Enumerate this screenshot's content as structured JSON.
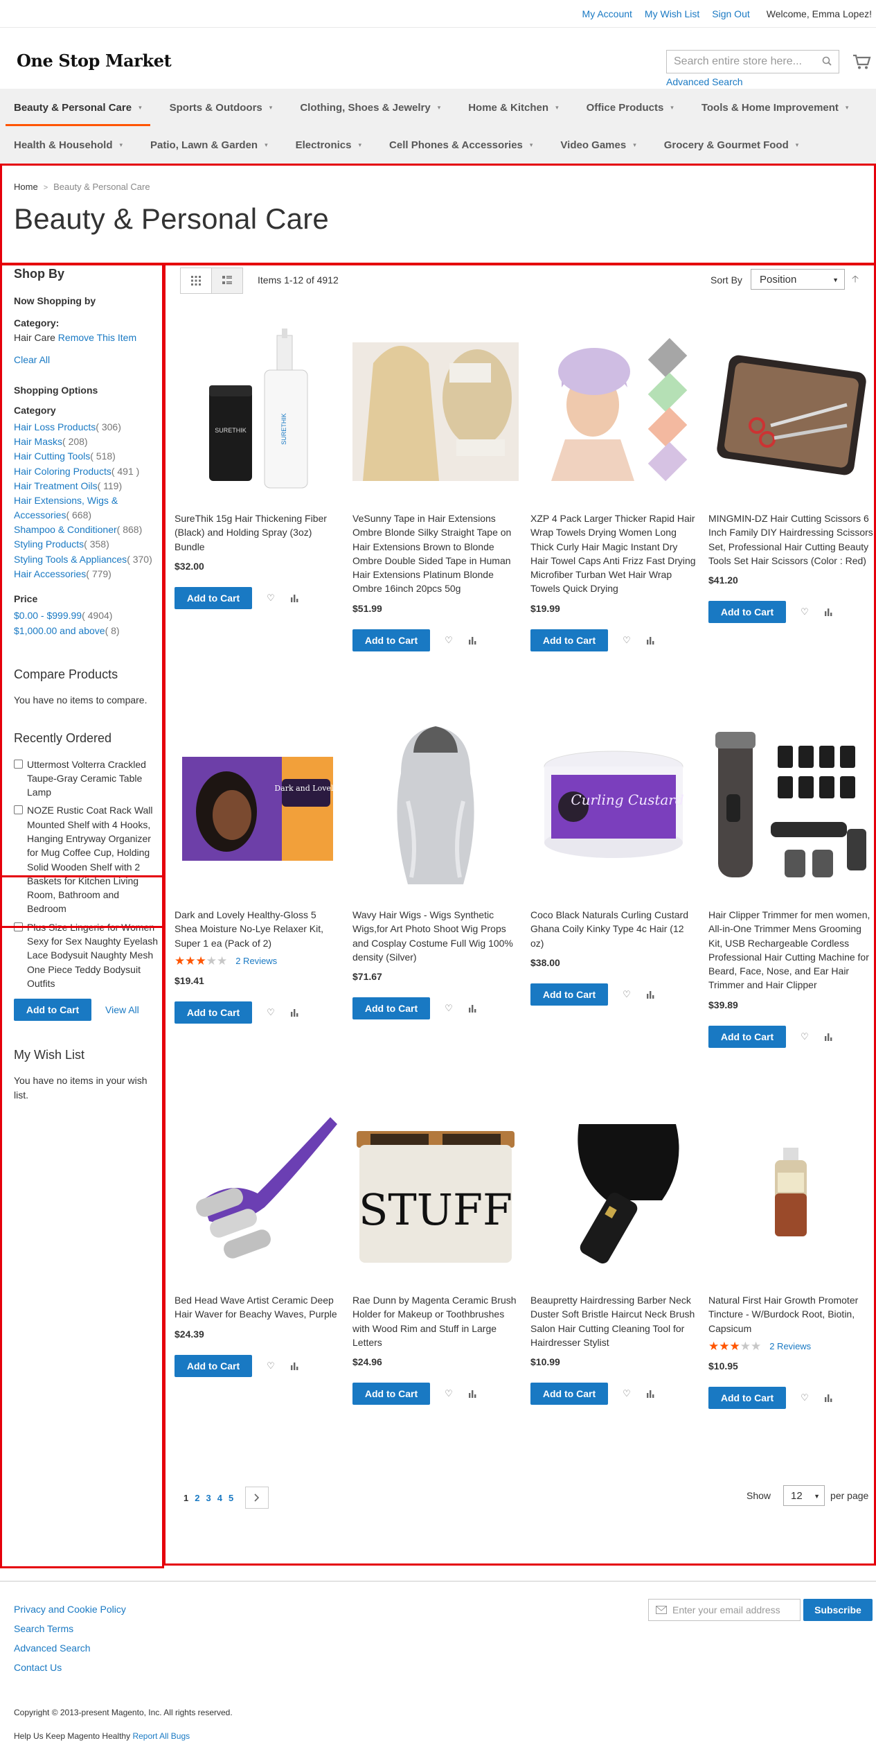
{
  "header": {
    "links": [
      "My Account",
      "My Wish List",
      "Sign Out"
    ],
    "welcome": "Welcome, Emma Lopez!",
    "logo": "One Stop Market",
    "search_placeholder": "Search entire store here...",
    "advanced_search": "Advanced Search"
  },
  "nav": {
    "row1": [
      "Beauty & Personal Care",
      "Sports & Outdoors",
      "Clothing, Shoes & Jewelry",
      "Home & Kitchen",
      "Office Products",
      "Tools & Home Improvement"
    ],
    "row2": [
      "Health & Household",
      "Patio, Lawn & Garden",
      "Electronics",
      "Cell Phones & Accessories",
      "Video Games",
      "Grocery & Gourmet Food"
    ]
  },
  "breadcrumb": {
    "home": "Home",
    "current": "Beauty & Personal Care"
  },
  "page_title": "Beauty & Personal Care",
  "sidebar": {
    "shop_by": "Shop By",
    "now_shopping_by": "Now Shopping by",
    "category_label": "Category:",
    "category_value": "Hair Care",
    "remove_item": "Remove This Item",
    "clear_all": "Clear All",
    "shopping_options": "Shopping Options",
    "category_heading": "Category",
    "categories": [
      {
        "name": "Hair Loss Products",
        "count": "( 306)"
      },
      {
        "name": "Hair Masks",
        "count": "( 208)"
      },
      {
        "name": "Hair Cutting Tools",
        "count": "( 518)"
      },
      {
        "name": "Hair Coloring Products",
        "count": "( 491 )"
      },
      {
        "name": "Hair Treatment Oils",
        "count": "( 119)"
      },
      {
        "name": "Hair Extensions, Wigs & Accessories",
        "count": "( 668)"
      },
      {
        "name": "Shampoo & Conditioner",
        "count": "( 868)"
      },
      {
        "name": "Styling Products",
        "count": "( 358)"
      },
      {
        "name": "Styling Tools & Appliances",
        "count": "( 370)"
      },
      {
        "name": "Hair Accessories",
        "count": "( 779)"
      }
    ],
    "price_heading": "Price",
    "prices": [
      {
        "range": "$0.00 - $999.99",
        "count": "( 4904)"
      },
      {
        "range": "$1,000.00 and above",
        "count": "( 8)"
      }
    ],
    "compare_title": "Compare Products",
    "compare_text": "You have no items to compare.",
    "recent_title": "Recently Ordered",
    "recent_items": [
      "Uttermost Volterra Crackled Taupe-Gray Ceramic Table Lamp",
      "NOZE Rustic Coat Rack Wall Mounted Shelf with 4 Hooks, Hanging Entryway Organizer for Mug Coffee Cup, Holding Solid Wooden Shelf with 2 Baskets for Kitchen Living Room, Bathroom and Bedroom",
      "Plus Size Lingerie for Women Sexy for Sex Naughty Eyelash Lace Bodysuit Naughty Mesh One Piece Teddy Bodysuit Outfits"
    ],
    "add_to_cart": "Add to Cart",
    "view_all": "View All",
    "wishlist_title": "My Wish List",
    "wishlist_text": "You have no items in your wish list."
  },
  "toolbar": {
    "amount": "Items 1-12 of 4912",
    "sort_label": "Sort By",
    "sort_value": "Position"
  },
  "products": [
    {
      "name": "SureThik 15g Hair Thickening Fiber (Black) and Holding Spray (3oz) Bundle",
      "price": "$32.00",
      "rating": null,
      "reviews": null
    },
    {
      "name": "VeSunny Tape in Hair Extensions Ombre Blonde Silky Straight Tape on Hair Extensions Brown to Blonde Ombre Double Sided Tape in Human Hair Extensions Platinum Blonde Ombre 16inch 20pcs 50g",
      "price": "$51.99",
      "rating": null,
      "reviews": null
    },
    {
      "name": "XZP 4 Pack Larger Thicker Rapid Hair Wrap Towels Drying Women Long Thick Curly Hair Magic Instant Dry Hair Towel Caps Anti Frizz Fast Drying Microfiber Turban Wet Hair Wrap Towels Quick Drying",
      "price": "$19.99",
      "rating": null,
      "reviews": null
    },
    {
      "name": "MINGMIN-DZ Hair Cutting Scissors 6 Inch Family DIY Hairdressing Scissors Set, Professional Hair Cutting Beauty Tools Set Hair Scissors (Color : Red)",
      "price": "$41.20",
      "rating": null,
      "reviews": null
    },
    {
      "name": "Dark and Lovely Healthy-Gloss 5 Shea Moisture No-Lye Relaxer Kit, Super 1 ea (Pack of 2)",
      "price": "$19.41",
      "rating": 3,
      "reviews": "2  Reviews"
    },
    {
      "name": "Wavy Hair Wigs - Wigs Synthetic Wigs,for Art Photo Shoot Wig Props and Cosplay Costume Full Wig 100% density (Silver)",
      "price": "$71.67",
      "rating": null,
      "reviews": null
    },
    {
      "name": "Coco Black Naturals Curling Custard Ghana Coily Kinky Type 4c Hair (12 oz)",
      "price": "$38.00",
      "rating": null,
      "reviews": null
    },
    {
      "name": "Hair Clipper Trimmer for men women, All-in-One Trimmer Mens Grooming Kit, USB Rechargeable Cordless Professional Hair Cutting Machine for Beard, Face, Nose, and Ear Hair Trimmer and Hair Clipper",
      "price": "$39.89",
      "rating": null,
      "reviews": null
    },
    {
      "name": "Bed Head Wave Artist Ceramic Deep Hair Waver for Beachy Waves, Purple",
      "price": "$24.39",
      "rating": null,
      "reviews": null
    },
    {
      "name": "Rae Dunn by Magenta Ceramic Brush Holder for Makeup or Toothbrushes with Wood Rim and Stuff in Large Letters",
      "price": "$24.96",
      "rating": null,
      "reviews": null
    },
    {
      "name": "Beaupretty Hairdressing Barber Neck Duster Soft Bristle Haircut Neck Brush Salon Hair Cutting Cleaning Tool for Hairdresser Stylist",
      "price": "$10.99",
      "rating": null,
      "reviews": null
    },
    {
      "name": "Natural First Hair Growth Promoter Tincture - W/Burdock Root, Biotin, Capsicum",
      "price": "$10.95",
      "rating": 3,
      "reviews": "2  Reviews"
    }
  ],
  "product_button": "Add to Cart",
  "image_texts": {
    "surethik_bottle": "SURETHIK",
    "curling_custard": "Curling Custard",
    "dark_lovely": "Dark and Lovely",
    "stuff": "STUFF"
  },
  "pager": {
    "pages": [
      "1",
      "2",
      "3",
      "4",
      "5"
    ],
    "show": "Show",
    "limit": "12",
    "per_page": "per page"
  },
  "footer": {
    "links": [
      "Privacy and Cookie Policy",
      "Search Terms",
      "Advanced Search",
      "Contact Us"
    ],
    "newsletter_placeholder": "Enter your email address",
    "subscribe": "Subscribe",
    "copyright": "Copyright © 2013-present Magento, Inc. All rights reserved.",
    "help_text": "Help Us Keep Magento Healthy",
    "report_bugs": "Report All Bugs"
  },
  "colors": {
    "link": "#1979c3",
    "accent": "#ff5501",
    "highlight": "#e5000b"
  }
}
